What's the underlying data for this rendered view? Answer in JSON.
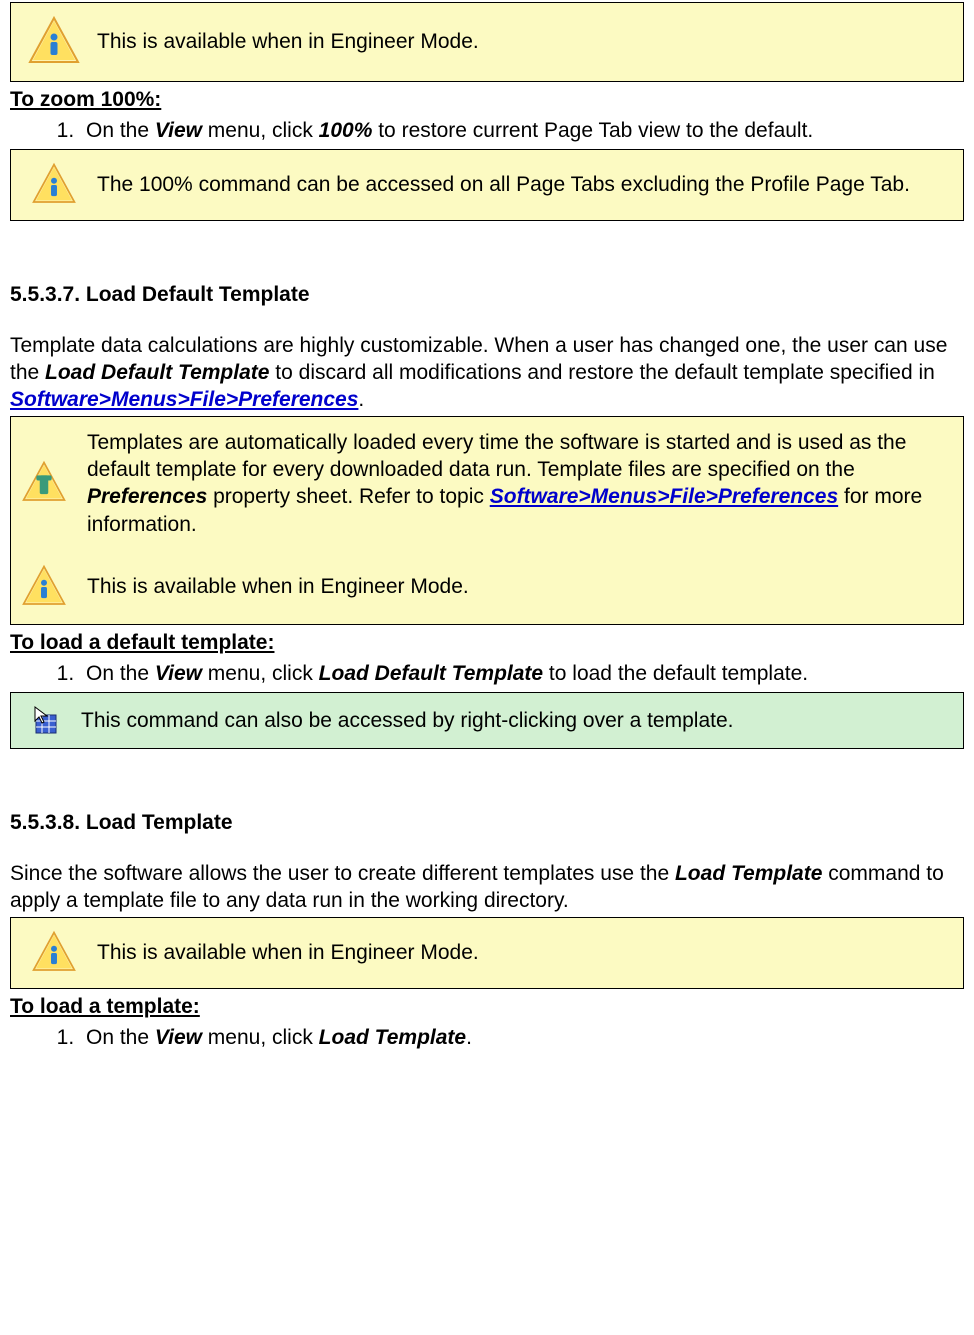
{
  "notes": {
    "engineer_mode": "This is available when in Engineer Mode.",
    "zoom_100_note": "The 100% command can be accessed on all Page Tabs excluding the Profile Page Tab.",
    "templates_auto_a": "Templates are automatically loaded every time the software is started and is used as the default template for every downloaded data run. Template files are specified on the ",
    "templates_auto_b": "Preferences",
    "templates_auto_c": " property sheet. Refer to topic ",
    "templates_auto_link": "Software>Menus>File>Preferences",
    "templates_auto_d": " for more information.",
    "right_click_template": "This command can also be accessed by right-clicking over a template."
  },
  "headings": {
    "zoom_100": "To zoom 100%:",
    "sec_5537": "5.5.3.7. Load Default Template",
    "load_default_template": "To load a default template:",
    "sec_5538": "5.5.3.8. Load Template",
    "load_template": "To load a template:"
  },
  "paras": {
    "p5537_a": "Template data calculations are highly customizable. When a user has changed one, the user can use the ",
    "p5537_b": "Load Default Template",
    "p5537_c": " to discard all modifications and restore the default template specified in ",
    "p5537_link": "Software>Menus>File>Preferences",
    "p5537_d": ".",
    "p5538_a": "Since the software allows the user to create different templates use the ",
    "p5538_b": "Load Template",
    "p5538_c": " command to apply a template file to any data run in the working directory."
  },
  "steps": {
    "zoom_a": "On the ",
    "zoom_b": "View",
    "zoom_c": " menu, click ",
    "zoom_d": "100%",
    "zoom_e": " to restore current Page Tab view to the default.",
    "ldt_a": "On the ",
    "ldt_b": "View",
    "ldt_c": " menu, click ",
    "ldt_d": "Load Default Template",
    "ldt_e": " to load the default template.",
    "lt_a": "On the ",
    "lt_b": "View",
    "lt_c": " menu, click ",
    "lt_d": "Load Template",
    "lt_e": "."
  }
}
